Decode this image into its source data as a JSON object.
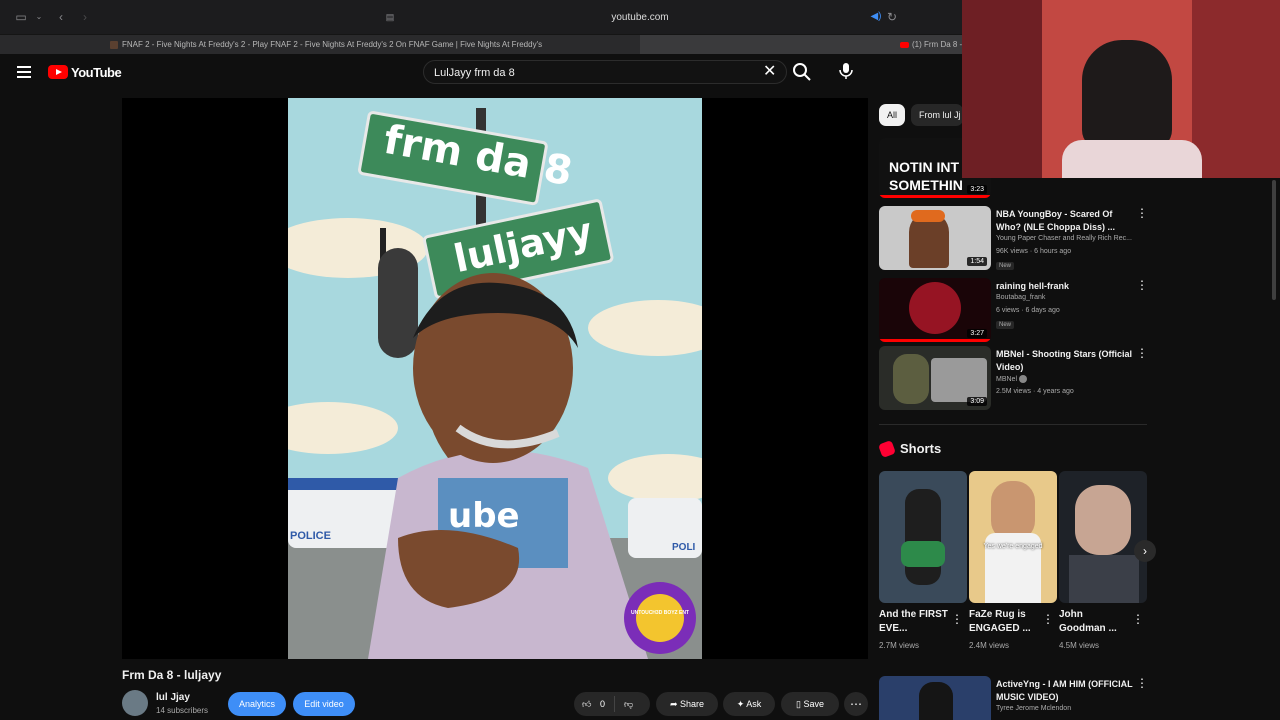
{
  "browser": {
    "url": "youtube.com",
    "tabs": [
      {
        "title": "FNAF 2 - Five Nights At Freddy's 2 - Play FNAF 2 - Five Nights At Freddy's 2 On FNAF Game | Five Nights At Freddy's"
      },
      {
        "title": "(1) Frm Da 8 -"
      }
    ]
  },
  "header": {
    "logo": "YouTube",
    "search": {
      "value": "LulJayy frm da 8"
    }
  },
  "video": {
    "title": "Frm Da 8 - luljayy",
    "art_sign_top": "frm da 8",
    "art_sign_bottom": "luljayy",
    "art_shirt": "ube",
    "art_police": "POLICE",
    "art_police2": "POLI",
    "art_badge": "UNTOUCH3D BOYZ ENT"
  },
  "channel": {
    "name": "lul Jjay",
    "subs": "14 subscribers"
  },
  "actions": {
    "analytics": "Analytics",
    "edit": "Edit video",
    "like_count": "0",
    "share": "Share",
    "ask": "Ask",
    "save": "Save"
  },
  "chips": {
    "all": "All",
    "from": "From lul Jj"
  },
  "related": [
    {
      "thumb_text": "NOTIN INT SOMETHIN",
      "duration": "3:23"
    },
    {
      "title": "NBA YoungBoy - Scared Of Who? (NLE Choppa Diss) ...",
      "channel": "Young Paper Chaser and Really Rich Rec...",
      "meta": "96K views · 6 hours ago",
      "badge": "New",
      "duration": "1:54"
    },
    {
      "title": "raining hell-frank",
      "channel": "Boutabag_frank",
      "meta": "6 views · 6 days ago",
      "badge": "New",
      "duration": "3:27"
    },
    {
      "title": "MBNel - Shooting Stars (Official Video)",
      "channel": "MBNel",
      "meta": "2.5M views · 4 years ago",
      "duration": "3:09"
    },
    {
      "title": "ActiveYng - I AM HIM (OFFICIAL MUSIC VIDEO)",
      "channel": "Tyree Jerome Mclendon"
    }
  ],
  "shorts": {
    "heading": "Shorts",
    "items": [
      {
        "title": "And the FIRST EVE...",
        "views": "2.7M views"
      },
      {
        "title": "FaZe Rug is ENGAGED ...",
        "views": "2.4M views",
        "overlay": "Yes we're engaged"
      },
      {
        "title": "John Goodman ...",
        "views": "4.5M views"
      }
    ]
  },
  "colors": {
    "accent_blue": "#3e8ef7",
    "brand_red": "#ff0000",
    "bg": "#0f0f0f"
  }
}
